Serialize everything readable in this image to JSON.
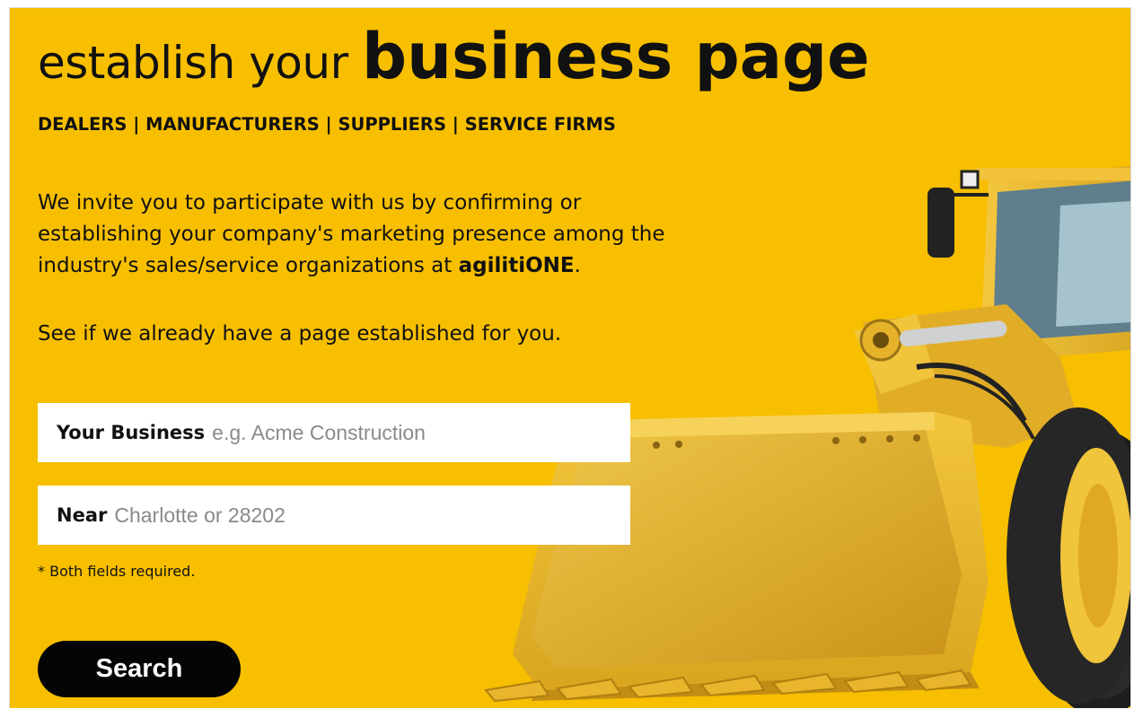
{
  "headline": {
    "regular": "establish your ",
    "bold": "business page"
  },
  "categories": "DEALERS | MANUFACTURERS | SUPPLIERS | SERVICE FIRMS",
  "intro": {
    "text": "We invite you to participate with us by confirming or establishing your company's marketing presence among the industry's sales/service organizations at ",
    "brand": "agilitiONE",
    "end": "."
  },
  "subintro": "See if we already have a page established for you.",
  "form": {
    "business": {
      "label": "Your Business",
      "placeholder": "e.g. Acme Construction",
      "value": ""
    },
    "near": {
      "label": "Near",
      "placeholder": "Charlotte or 28202",
      "value": ""
    },
    "required_note": "* Both fields required.",
    "search_label": "Search"
  },
  "colors": {
    "background": "#f7bf00",
    "button": "#050505",
    "machine": "#e8b52c"
  },
  "image": {
    "subject": "wheel-loader-illustration"
  }
}
